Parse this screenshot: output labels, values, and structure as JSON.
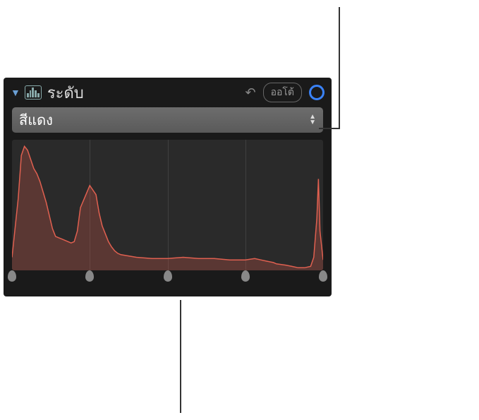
{
  "header": {
    "title": "ระดับ",
    "auto_label": "ออโต้"
  },
  "dropdown": {
    "selected": "สีแดง"
  },
  "sliders": {
    "positions": [
      0,
      25,
      50,
      75,
      100
    ]
  },
  "grid": {
    "positions": [
      25,
      50,
      75
    ]
  },
  "chart_data": {
    "type": "area",
    "title": "",
    "xlabel": "",
    "ylabel": "",
    "xlim": [
      0,
      100
    ],
    "ylim": [
      0,
      100
    ],
    "x": [
      0,
      2,
      3,
      4,
      5,
      6,
      7,
      8,
      9,
      10,
      11,
      12,
      13,
      14,
      15,
      16,
      17,
      18,
      19,
      20,
      21,
      22,
      25,
      27,
      28,
      29,
      30,
      31,
      32,
      33,
      34,
      35,
      40,
      45,
      50,
      55,
      60,
      65,
      70,
      75,
      78,
      80,
      82,
      84,
      85,
      88,
      90,
      92,
      94,
      96,
      97,
      98,
      98.5,
      99,
      100
    ],
    "values": [
      10,
      55,
      88,
      95,
      92,
      85,
      78,
      74,
      68,
      60,
      52,
      42,
      32,
      26,
      25,
      24,
      23,
      22,
      21,
      22,
      30,
      48,
      65,
      58,
      44,
      34,
      28,
      22,
      18,
      15,
      13,
      12,
      10,
      9,
      9,
      10,
      9,
      9,
      8,
      8,
      9,
      8,
      7,
      6,
      5,
      4,
      3,
      2,
      2,
      3,
      10,
      40,
      70,
      30,
      8
    ],
    "color": "#e06050",
    "fill": "rgba(180,80,70,0.35)"
  }
}
